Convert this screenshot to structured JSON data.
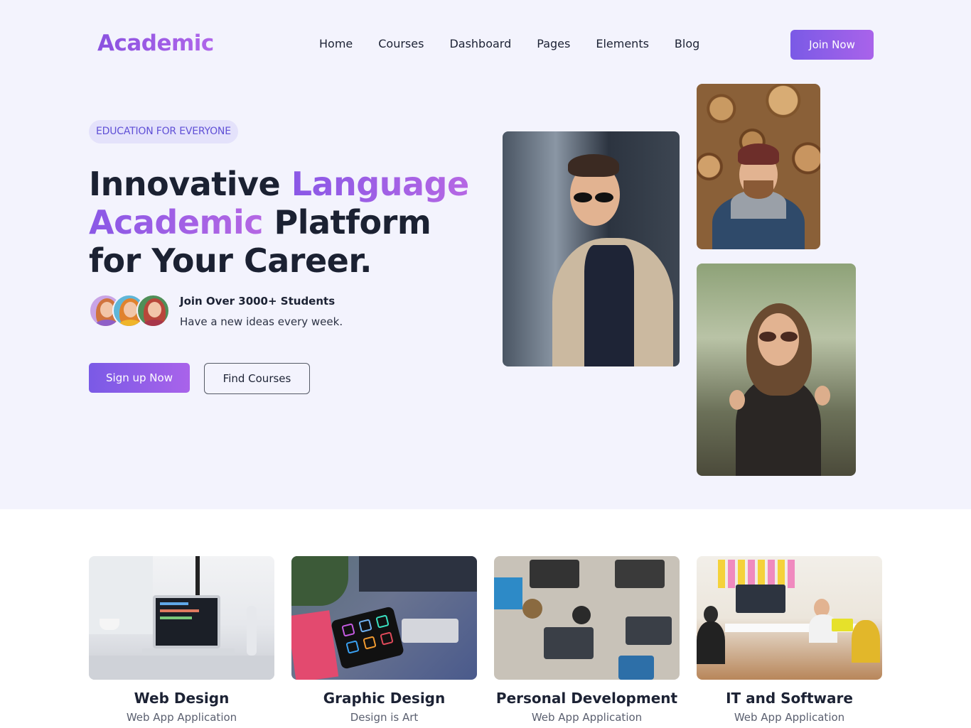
{
  "header": {
    "logo": "Academic",
    "nav": [
      "Home",
      "Courses",
      "Dashboard",
      "Pages",
      "Elements",
      "Blog"
    ],
    "cta": "Join Now"
  },
  "hero": {
    "badge": "EDUCATION FOR EVERYONE",
    "headline_part1": "Innovative ",
    "headline_highlight1": "Language",
    "headline_highlight2": "Academic",
    "headline_part2": " Platform for Your Career.",
    "students_title": "Join Over 3000+ Students",
    "students_sub": "Have a new ideas every week.",
    "primary_cta": "Sign up Now",
    "secondary_cta": "Find Courses"
  },
  "categories": [
    {
      "title": "Web Design",
      "subtitle": "Web App Application"
    },
    {
      "title": "Graphic Design",
      "subtitle": "Design is Art"
    },
    {
      "title": "Personal Development",
      "subtitle": "Web App Application"
    },
    {
      "title": "IT and Software",
      "subtitle": "Web App Application"
    }
  ],
  "colors": {
    "accent": "#7a5ae6",
    "accent_end": "#a963ea",
    "hero_bg": "#f3f3fd",
    "text": "#1c2234"
  }
}
